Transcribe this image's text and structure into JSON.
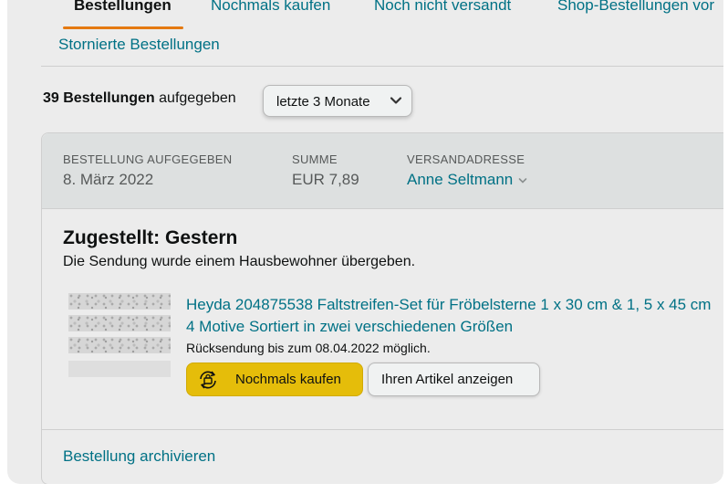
{
  "tabs": {
    "items": [
      {
        "label": "Bestellungen",
        "active": true
      },
      {
        "label": "Nochmals kaufen",
        "active": false
      },
      {
        "label": "Noch nicht versandt",
        "active": false
      },
      {
        "label": "Shop-Bestellungen vor",
        "active": false
      }
    ],
    "second_row": "Stornierte Bestellungen"
  },
  "summary": {
    "count": "39 Bestellungen",
    "suffix": "aufgegeben",
    "filter_value": "letzte 3 Monate"
  },
  "order": {
    "header": {
      "placed_label": "BESTELLUNG AUFGEGEBEN",
      "placed_value": "8. März 2022",
      "total_label": "SUMME",
      "total_value": "EUR 7,89",
      "address_label": "VERSANDADRESSE",
      "address_value": "Anne Seltmann"
    },
    "status": "Zugestellt: Gestern",
    "substatus": "Die Sendung wurde einem Hausbewohner übergeben.",
    "item": {
      "title_line1": "Heyda 204875538 Faltstreifen-Set für Fröbelsterne 1 x 30 cm & 1, 5 x 45 cm",
      "title_line2": "4 Motive Sortiert in zwei verschiedenen Größen",
      "return_note": "Rücksendung bis zum 08.04.2022 möglich.",
      "buy_again_label": "Nochmals kaufen",
      "view_item_label": "Ihren Artikel anzeigen"
    },
    "archive_label": "Bestellung archivieren"
  },
  "colors": {
    "link": "#007185",
    "accent_tab": "#e47911",
    "buy_again_button": "#e5bd0a",
    "header_bg": "#dde0e0"
  },
  "icons": {
    "filter_chevron": "chevron-down-icon",
    "address_chevron": "chevron-down-icon",
    "buy_again": "reorder-icon"
  }
}
